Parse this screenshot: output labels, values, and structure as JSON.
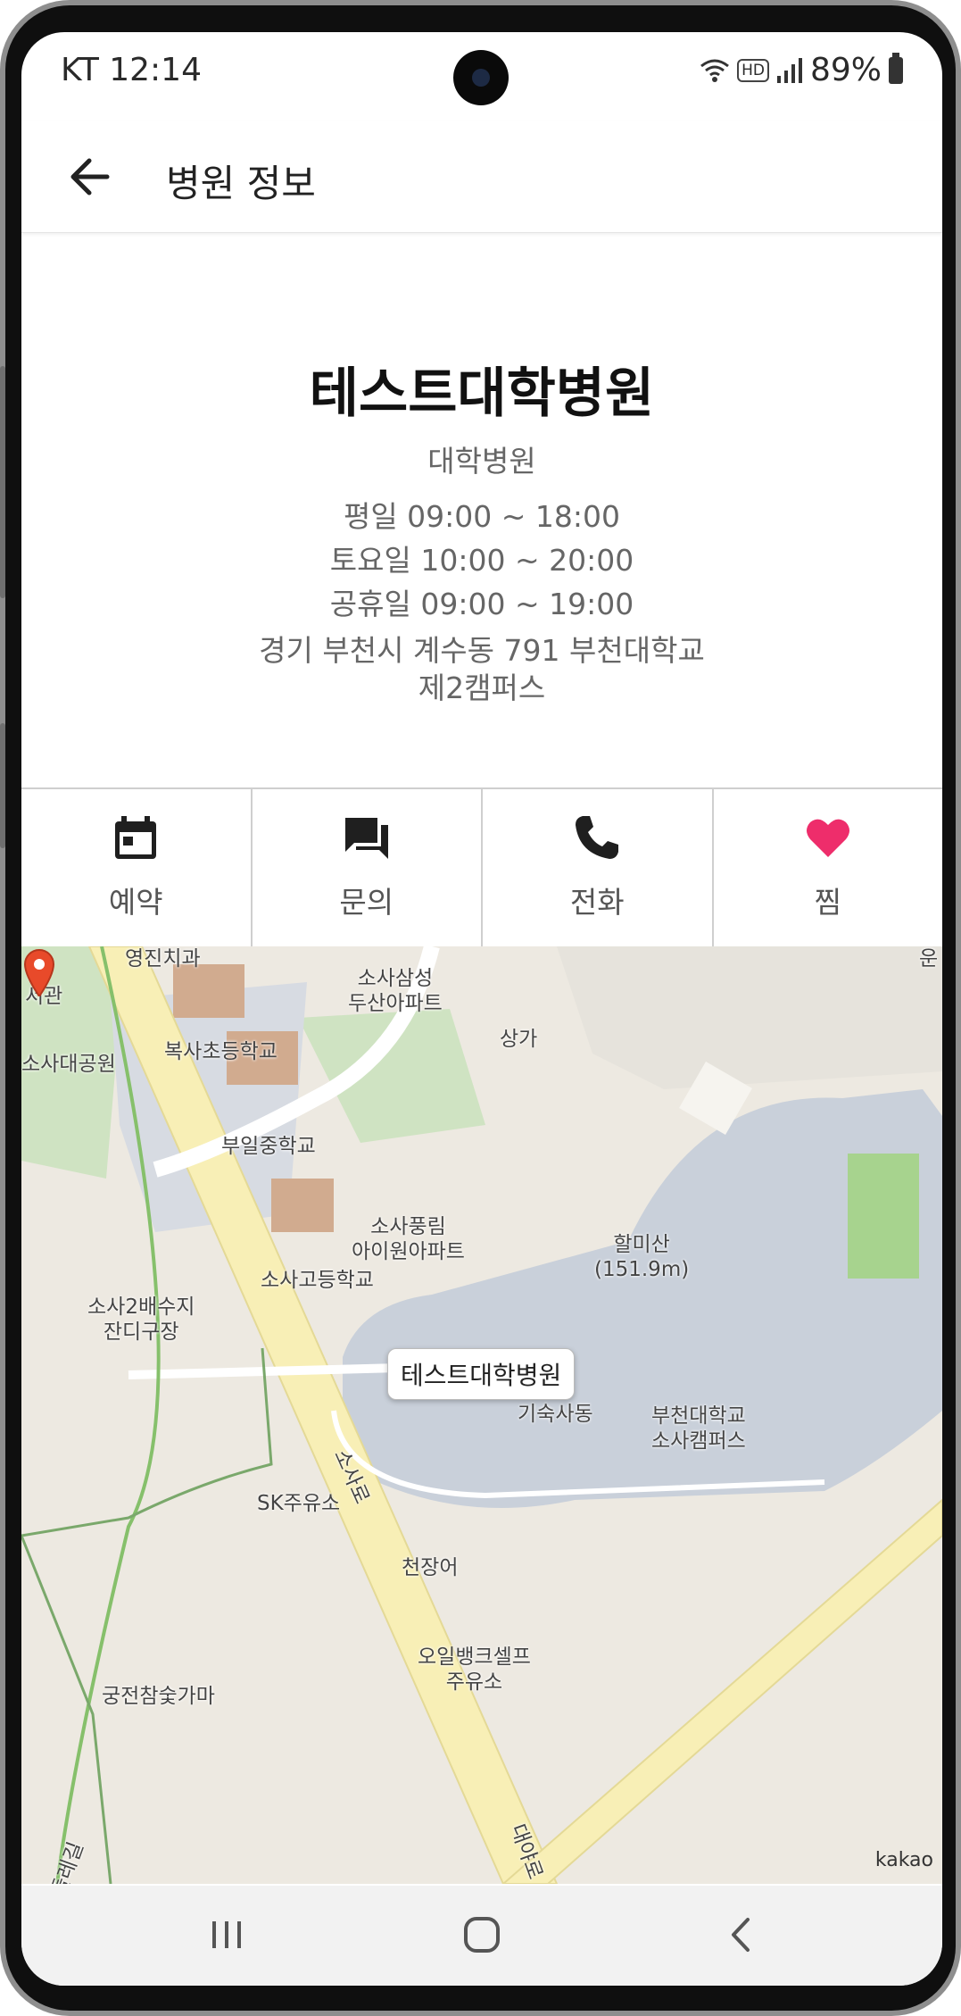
{
  "status": {
    "carrier_time": "KT 12:14",
    "hd": "HD",
    "battery": "89%"
  },
  "appbar": {
    "title": "병원 정보"
  },
  "hospital": {
    "name": "테스트대학병원",
    "type": "대학병원",
    "hours": [
      "평일 09:00 ~ 18:00",
      "토요일 10:00 ~ 20:00",
      "공휴일 09:00 ~ 19:00"
    ],
    "address_line1": "경기 부천시 계수동 791 부천대학교",
    "address_line2": "제2캠퍼스"
  },
  "actions": [
    {
      "label": "예약",
      "icon": "calendar-icon"
    },
    {
      "label": "문의",
      "icon": "chat-icon"
    },
    {
      "label": "전화",
      "icon": "phone-icon"
    },
    {
      "label": "찜",
      "icon": "heart-icon"
    }
  ],
  "map": {
    "marker_label": "테스트대학병원",
    "labels": {
      "youngjin": "영진치과",
      "library_a": "립",
      "library_b": "서관",
      "sosa_park": "소사대공원",
      "samsung_a": "소사삼성",
      "samsung_b": "두산아파트",
      "store": "상가",
      "boksa": "복사초등학교",
      "buil": "부일중학교",
      "pungnim_a": "소사풍림",
      "pungnim_b": "아이원아파트",
      "halmi_a": "할미산",
      "halmi_b": "(151.9m)",
      "sosa_high": "소사고등학교",
      "reservoir_a": "소사2배수지",
      "reservoir_b": "잔디구장",
      "dorm": "기숙사동",
      "univ_a": "부천대학교",
      "univ_b": "소사캠퍼스",
      "road_sosa": "소사로",
      "sk": "SK주유소",
      "eel": "천장어",
      "oilbank_a": "오일뱅크셀프",
      "oilbank_b": "주유소",
      "charcoal": "궁전참숯가마",
      "road_daeya": "대야로",
      "trail": "둘레길",
      "edge_tr": "운"
    },
    "attribution": "kakao"
  },
  "colors": {
    "heart": "#ee2d6b",
    "icon": "#1f1f1f",
    "map_bg": "#ede9e1",
    "campus": "#c9d0da",
    "road": "#f8efb6",
    "green": "#cfe3c2"
  }
}
